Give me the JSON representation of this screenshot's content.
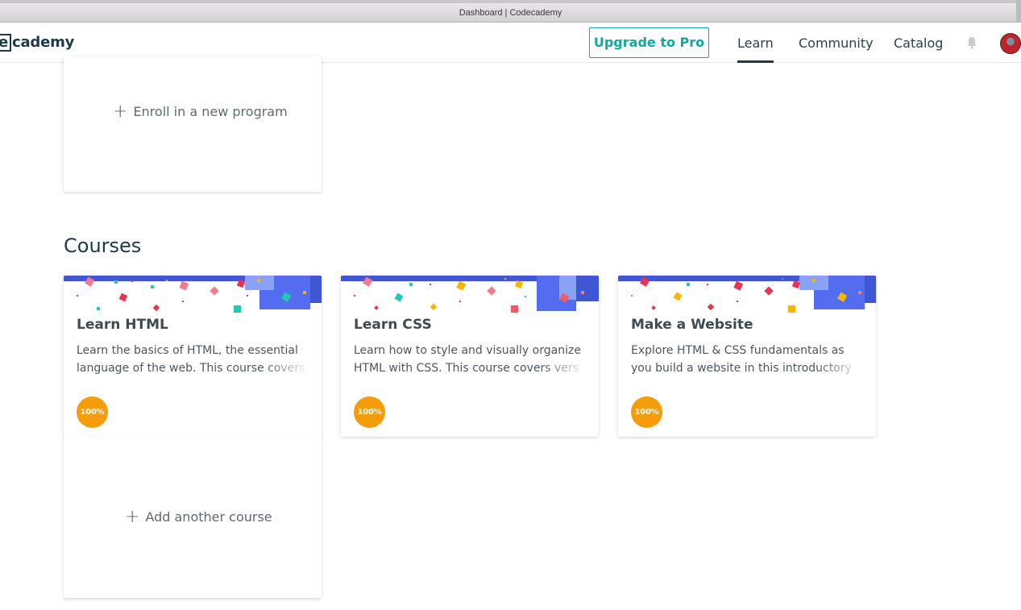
{
  "window": {
    "title": "Dashboard | Codecademy"
  },
  "header": {
    "logo_box": "e",
    "logo_text": "cademy",
    "upgrade_label": "Upgrade to Pro",
    "nav": {
      "learn": "Learn",
      "community": "Community",
      "catalog": "Catalog"
    },
    "icons": {
      "bell": "bell-icon",
      "avatar": "avatar"
    }
  },
  "programs": {
    "enroll_label": "Enroll in a new program"
  },
  "courses": {
    "section_title": "Courses",
    "items": [
      {
        "title": "Learn HTML",
        "description": "Learn the basics of HTML, the essential language of the web. This course covers",
        "progress": "100%"
      },
      {
        "title": "Learn CSS",
        "description": "Learn how to style and visually organize HTML with CSS. This course covers vers",
        "progress": "100%"
      },
      {
        "title": "Make a Website",
        "description": "Explore HTML & CSS fundamentals as you build a website in this introductory cour",
        "progress": "100%"
      }
    ],
    "add_label": "Add another course"
  },
  "colors": {
    "accent": "#12a7a0",
    "brand_navy": "#1e3a4a",
    "badge": "#f59c0a",
    "banner_blue": "#3f57d3"
  }
}
